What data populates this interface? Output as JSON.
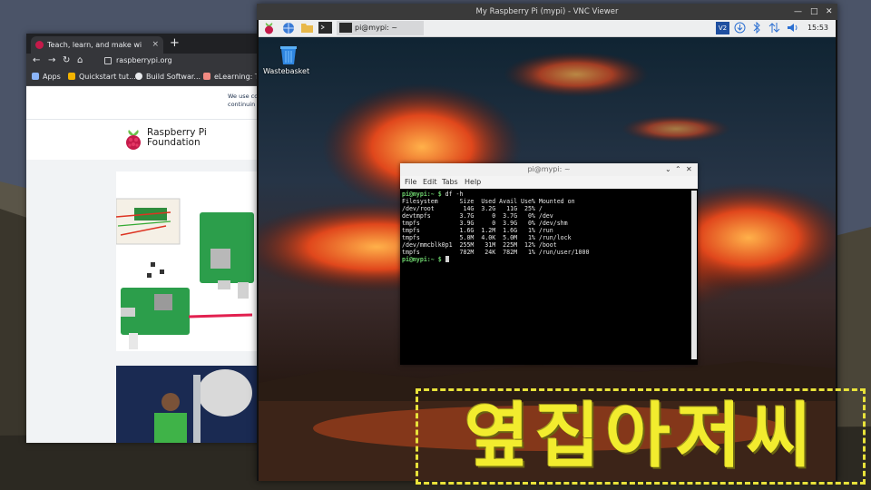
{
  "browser": {
    "tab_title": "Teach, learn, and make wi",
    "tab_close": "×",
    "new_tab": "+",
    "url": "raspberrypi.org",
    "bookmarks": [
      "Apps",
      "Quickstart tut...",
      "Build Softwar...",
      "eLearning: Ta"
    ],
    "cookie_line1": "We use co",
    "cookie_line2": "continuin",
    "org_name_line1": "Raspberry Pi",
    "org_name_line2": "Foundation"
  },
  "vnc": {
    "title": "My Raspberry Pi (mypi) - VNC Viewer",
    "controls": [
      "—",
      "□",
      "✕"
    ]
  },
  "pi_desktop": {
    "taskbar_task_label": "pi@mypi: ~",
    "clock": "15:53",
    "trash_label": "Wastebasket",
    "tray_vnc_label": "V2"
  },
  "terminal": {
    "title": "pi@mypi: ~",
    "title_controls": [
      "⌄",
      "⌃",
      "✕"
    ],
    "menu": [
      "File",
      "Edit",
      "Tabs",
      "Help"
    ],
    "prompt": "pi@mypi:~ $",
    "command": " df -h",
    "output_lines": [
      "Filesystem      Size  Used Avail Use% Mounted on",
      "/dev/root        14G  3.2G   11G  25% /",
      "devtmpfs        3.7G     0  3.7G   0% /dev",
      "tmpfs           3.9G     0  3.9G   0% /dev/shm",
      "tmpfs           1.6G  1.2M  1.6G   1% /run",
      "tmpfs           5.0M  4.0K  5.0M   1% /run/lock",
      "/dev/mmcblk0p1  255M   31M  225M  12% /boot",
      "tmpfs           782M   24K  782M   1% /run/user/1000"
    ],
    "final_prompt": "pi@mypi:~ $ "
  },
  "watermark": {
    "text": "옆집아저씨"
  },
  "colors": {
    "raspberry": "#c51a4a",
    "prompt_green": "#6dd36d",
    "stamp_yellow": "#f2ec2e"
  }
}
